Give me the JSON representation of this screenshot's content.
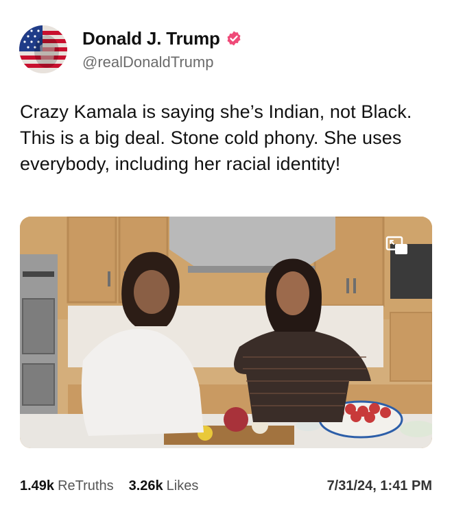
{
  "author": {
    "display_name": "Donald J. Trump",
    "handle": "@realDonaldTrump",
    "verified": true,
    "avatar_icon": "flag-portrait-avatar",
    "verified_color": "#ef4a78"
  },
  "post": {
    "text": "Crazy Kamala is saying she’s Indian, not Black. This is a big deal. Stone cold phony. She uses everybody, including her racial identity!"
  },
  "media": {
    "type": "video",
    "pip_icon": "picture-in-picture-icon"
  },
  "stats": {
    "retruths_count": "1.49k",
    "retruths_label": "ReTruths",
    "likes_count": "3.26k",
    "likes_label": "Likes",
    "timestamp": "7/31/24, 1:41 PM"
  }
}
